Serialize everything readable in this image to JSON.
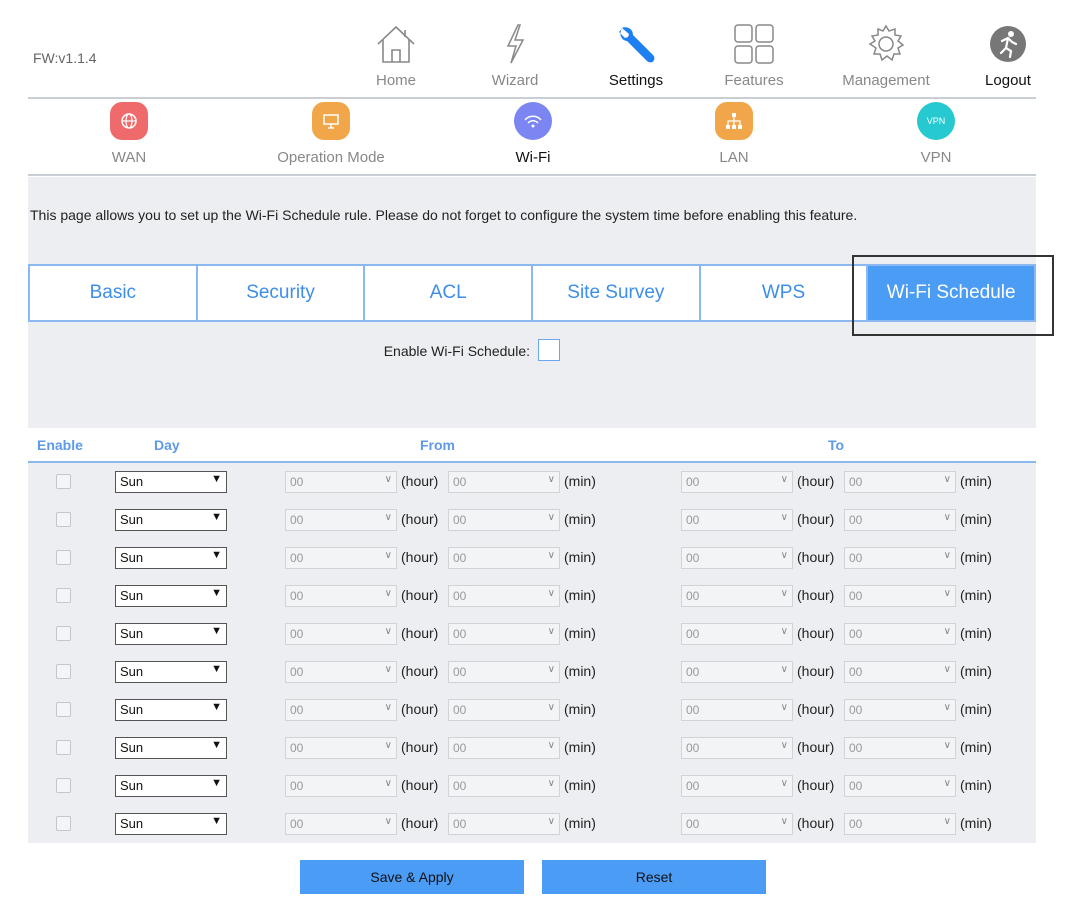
{
  "firmware": "FW:v1.1.4",
  "top_nav": [
    {
      "label": "Home",
      "icon": "home-icon"
    },
    {
      "label": "Wizard",
      "icon": "wizard-icon"
    },
    {
      "label": "Settings",
      "icon": "wrench-icon"
    },
    {
      "label": "Features",
      "icon": "grid-icon"
    },
    {
      "label": "Management",
      "icon": "gear-icon"
    },
    {
      "label": "Logout",
      "icon": "logout-icon"
    }
  ],
  "sub_nav": [
    {
      "label": "WAN",
      "icon": "globe-icon",
      "color": "#ef6b6b"
    },
    {
      "label": "Operation Mode",
      "icon": "monitor-icon",
      "color": "#f2a64a"
    },
    {
      "label": "Wi-Fi",
      "icon": "wifi-icon",
      "color": "#7b86f2"
    },
    {
      "label": "LAN",
      "icon": "network-icon",
      "color": "#f2a64a"
    },
    {
      "label": "VPN",
      "icon": "vpn-icon",
      "color": "#26c9d0",
      "badge": "VPN"
    }
  ],
  "description": "This page allows you to set up the Wi-Fi Schedule rule. Please do not forget to configure the system time before enabling this feature.",
  "tabs": [
    "Basic",
    "Security",
    "ACL",
    "Site Survey",
    "WPS",
    "Wi-Fi Schedule"
  ],
  "active_tab": "Wi-Fi Schedule",
  "enable_label": "Enable Wi-Fi Schedule:",
  "table": {
    "headers": {
      "enable": "Enable",
      "day": "Day",
      "from": "From",
      "to": "To"
    },
    "unit_hour": "(hour)",
    "unit_min": "(min)",
    "rows": [
      {
        "day": "Sun",
        "from_hour": "00",
        "from_min": "00",
        "to_hour": "00",
        "to_min": "00"
      },
      {
        "day": "Sun",
        "from_hour": "00",
        "from_min": "00",
        "to_hour": "00",
        "to_min": "00"
      },
      {
        "day": "Sun",
        "from_hour": "00",
        "from_min": "00",
        "to_hour": "00",
        "to_min": "00"
      },
      {
        "day": "Sun",
        "from_hour": "00",
        "from_min": "00",
        "to_hour": "00",
        "to_min": "00"
      },
      {
        "day": "Sun",
        "from_hour": "00",
        "from_min": "00",
        "to_hour": "00",
        "to_min": "00"
      },
      {
        "day": "Sun",
        "from_hour": "00",
        "from_min": "00",
        "to_hour": "00",
        "to_min": "00"
      },
      {
        "day": "Sun",
        "from_hour": "00",
        "from_min": "00",
        "to_hour": "00",
        "to_min": "00"
      },
      {
        "day": "Sun",
        "from_hour": "00",
        "from_min": "00",
        "to_hour": "00",
        "to_min": "00"
      },
      {
        "day": "Sun",
        "from_hour": "00",
        "from_min": "00",
        "to_hour": "00",
        "to_min": "00"
      },
      {
        "day": "Sun",
        "from_hour": "00",
        "from_min": "00",
        "to_hour": "00",
        "to_min": "00"
      }
    ]
  },
  "buttons": {
    "save": "Save & Apply",
    "reset": "Reset"
  },
  "colors": {
    "accent": "#4b9cf5",
    "tab_border": "#8cb8f2",
    "panel": "#eceef1"
  }
}
